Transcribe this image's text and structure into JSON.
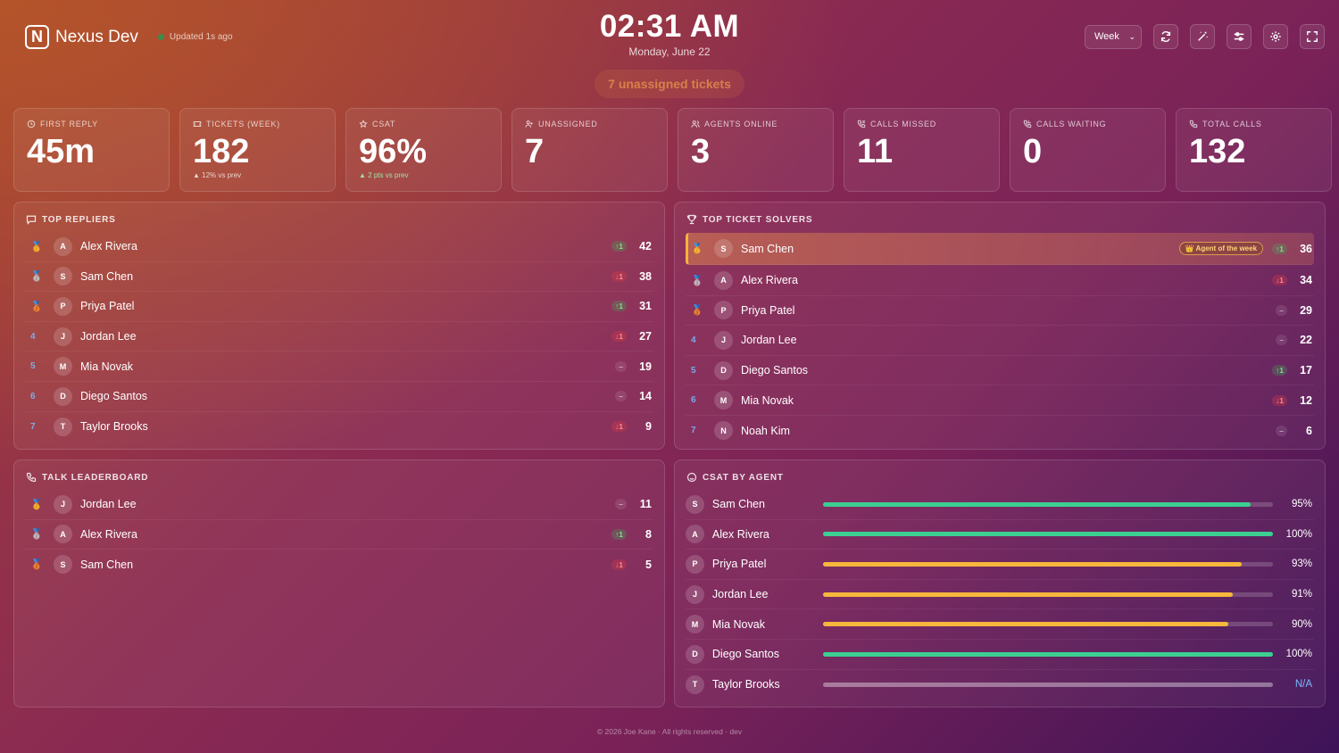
{
  "header": {
    "brand_initial": "N",
    "brand_name": "Nexus Dev",
    "updated": "Updated 1s ago",
    "time": "02:31 AM",
    "date": "Monday, June 22",
    "unassigned_pill": "7 unassigned tickets",
    "period_select": "Week",
    "status_color": "#3b8c4a"
  },
  "stats": [
    {
      "label": "FIRST REPLY",
      "icon": "clock-icon",
      "value": "45m",
      "delta": ""
    },
    {
      "label": "TICKETS (WEEK)",
      "icon": "ticket-icon",
      "value": "182",
      "delta": "▲ 12% vs prev"
    },
    {
      "label": "CSAT",
      "icon": "star-icon",
      "value": "96%",
      "delta": "▲ 2 pts vs prev"
    },
    {
      "label": "UNASSIGNED",
      "icon": "user-plus-icon",
      "value": "7",
      "delta": ""
    },
    {
      "label": "AGENTS ONLINE",
      "icon": "users-icon",
      "value": "3",
      "delta": ""
    },
    {
      "label": "CALLS MISSED",
      "icon": "phone-missed-icon",
      "value": "11",
      "delta": ""
    },
    {
      "label": "CALLS WAITING",
      "icon": "phone-waiting-icon",
      "value": "0",
      "delta": ""
    },
    {
      "label": "TOTAL CALLS",
      "icon": "phone-icon",
      "value": "132",
      "delta": ""
    }
  ],
  "top_repliers": {
    "title": "TOP REPLIERS",
    "rows": [
      {
        "rank": "🥇",
        "initial": "A",
        "name": "Alex Rivera",
        "trend": "↑1",
        "dir": "up",
        "score": "42"
      },
      {
        "rank": "🥈",
        "initial": "S",
        "name": "Sam Chen",
        "trend": "↓1",
        "dir": "down",
        "score": "38"
      },
      {
        "rank": "🥉",
        "initial": "P",
        "name": "Priya Patel",
        "trend": "↑1",
        "dir": "up",
        "score": "31"
      },
      {
        "rank": "4",
        "initial": "J",
        "name": "Jordan Lee",
        "trend": "↓1",
        "dir": "down",
        "score": "27"
      },
      {
        "rank": "5",
        "initial": "M",
        "name": "Mia Novak",
        "trend": "–",
        "dir": "flat",
        "score": "19"
      },
      {
        "rank": "6",
        "initial": "D",
        "name": "Diego Santos",
        "trend": "–",
        "dir": "flat",
        "score": "14"
      },
      {
        "rank": "7",
        "initial": "T",
        "name": "Taylor Brooks",
        "trend": "↓1",
        "dir": "down",
        "score": "9"
      }
    ]
  },
  "top_solvers": {
    "title": "TOP TICKET SOLVERS",
    "badge": "👑 Agent of the week",
    "rows": [
      {
        "rank": "🥇",
        "initial": "S",
        "name": "Sam Chen",
        "trend": "↑1",
        "dir": "up",
        "score": "36"
      },
      {
        "rank": "🥈",
        "initial": "A",
        "name": "Alex Rivera",
        "trend": "↓1",
        "dir": "down",
        "score": "34"
      },
      {
        "rank": "🥉",
        "initial": "P",
        "name": "Priya Patel",
        "trend": "–",
        "dir": "flat",
        "score": "29"
      },
      {
        "rank": "4",
        "initial": "J",
        "name": "Jordan Lee",
        "trend": "–",
        "dir": "flat",
        "score": "22"
      },
      {
        "rank": "5",
        "initial": "D",
        "name": "Diego Santos",
        "trend": "↑1",
        "dir": "up",
        "score": "17"
      },
      {
        "rank": "6",
        "initial": "M",
        "name": "Mia Novak",
        "trend": "↓1",
        "dir": "down",
        "score": "12"
      },
      {
        "rank": "7",
        "initial": "N",
        "name": "Noah Kim",
        "trend": "–",
        "dir": "flat",
        "score": "6"
      }
    ]
  },
  "talk_leaderboard": {
    "title": "TALK LEADERBOARD",
    "rows": [
      {
        "rank": "🥇",
        "initial": "J",
        "name": "Jordan Lee",
        "trend": "–",
        "dir": "flat",
        "score": "11"
      },
      {
        "rank": "🥈",
        "initial": "A",
        "name": "Alex Rivera",
        "trend": "↑1",
        "dir": "up",
        "score": "8"
      },
      {
        "rank": "🥉",
        "initial": "S",
        "name": "Sam Chen",
        "trend": "↓1",
        "dir": "down",
        "score": "5"
      }
    ]
  },
  "csat_by_agent": {
    "title": "CSAT BY AGENT",
    "colors": {
      "high": "#3ccf91",
      "mid": "#f6b73c",
      "none": "rgba(255,255,255,0.25)"
    },
    "rows": [
      {
        "initial": "S",
        "name": "Sam Chen",
        "pct_label": "95%",
        "value": 95,
        "level": "high"
      },
      {
        "initial": "A",
        "name": "Alex Rivera",
        "pct_label": "100%",
        "value": 100,
        "level": "high"
      },
      {
        "initial": "P",
        "name": "Priya Patel",
        "pct_label": "93%",
        "value": 93,
        "level": "mid"
      },
      {
        "initial": "J",
        "name": "Jordan Lee",
        "pct_label": "91%",
        "value": 91,
        "level": "mid"
      },
      {
        "initial": "M",
        "name": "Mia Novak",
        "pct_label": "90%",
        "value": 90,
        "level": "mid"
      },
      {
        "initial": "D",
        "name": "Diego Santos",
        "pct_label": "100%",
        "value": 100,
        "level": "high"
      },
      {
        "initial": "T",
        "name": "Taylor Brooks",
        "pct_label": "N/A",
        "value": 100,
        "level": "none"
      }
    ]
  },
  "footer": "© 2026 Joe Kane · All rights reserved · dev"
}
